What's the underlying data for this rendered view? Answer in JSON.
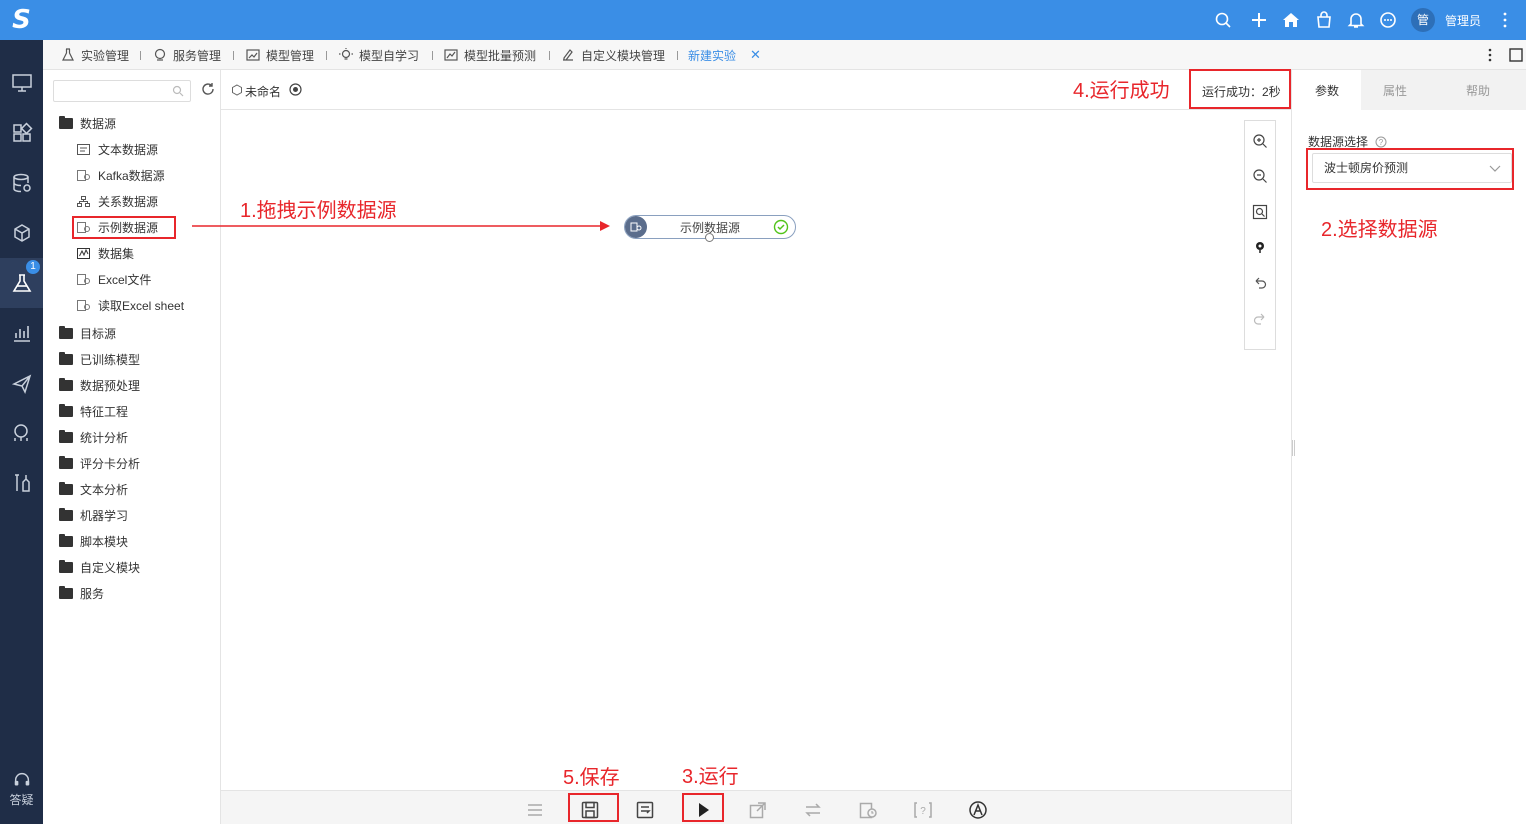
{
  "colors": {
    "accent": "#3a8ee6",
    "nav_bg": "#1f2d47",
    "annotation": "#e8262b",
    "success": "#52c41a"
  },
  "leftnav": {
    "logo": "S",
    "items": [
      {
        "icon": "monitor-icon"
      },
      {
        "icon": "grid-icon"
      },
      {
        "icon": "database-icon"
      },
      {
        "icon": "cube-icon"
      },
      {
        "icon": "experiment-icon",
        "active": true
      },
      {
        "icon": "chart-icon"
      },
      {
        "icon": "send-icon"
      },
      {
        "icon": "analysis-icon"
      },
      {
        "icon": "tools-icon"
      }
    ],
    "badge": "1",
    "help_label": "答疑"
  },
  "topbar": {
    "icons": [
      "search-icon",
      "plus-icon",
      "home-icon",
      "bag-icon",
      "bell-icon",
      "chat-icon"
    ],
    "avatar": "管",
    "username": "管理员"
  },
  "tabs": [
    {
      "label": "实验管理",
      "icon": "flask-icon"
    },
    {
      "label": "服务管理",
      "icon": "service-icon"
    },
    {
      "label": "模型管理",
      "icon": "model-icon"
    },
    {
      "label": "模型自学习",
      "icon": "bulb-icon"
    },
    {
      "label": "模型批量预测",
      "icon": "batch-chart-icon"
    },
    {
      "label": "自定义模块管理",
      "icon": "edit-doc-icon"
    },
    {
      "label": "新建实验",
      "active": true,
      "closable": true
    }
  ],
  "tree": {
    "search_placeholder": "",
    "datasource_root": "数据源",
    "datasource_children": [
      "文本数据源",
      "Kafka数据源",
      "关系数据源",
      "示例数据源",
      "数据集",
      "Excel文件",
      "读取Excel sheet"
    ],
    "folders": [
      "目标源",
      "已训练模型",
      "数据预处理",
      "特征工程",
      "统计分析",
      "评分卡分析",
      "文本分析",
      "机器学习",
      "脚本模块",
      "自定义模块",
      "服务"
    ]
  },
  "canvas": {
    "experiment_name": "未命名",
    "run_status": "运行成功：2秒",
    "node_label": "示例数据源"
  },
  "rightpanel": {
    "tabs": [
      "参数",
      "属性",
      "帮助"
    ],
    "field_label": "数据源选择",
    "field_value": "波士顿房价预测"
  },
  "annotations": {
    "step1": "1.拖拽示例数据源",
    "step2": "2.选择数据源",
    "step3": "3.运行",
    "step4": "4.运行成功",
    "step5": "5.保存"
  }
}
